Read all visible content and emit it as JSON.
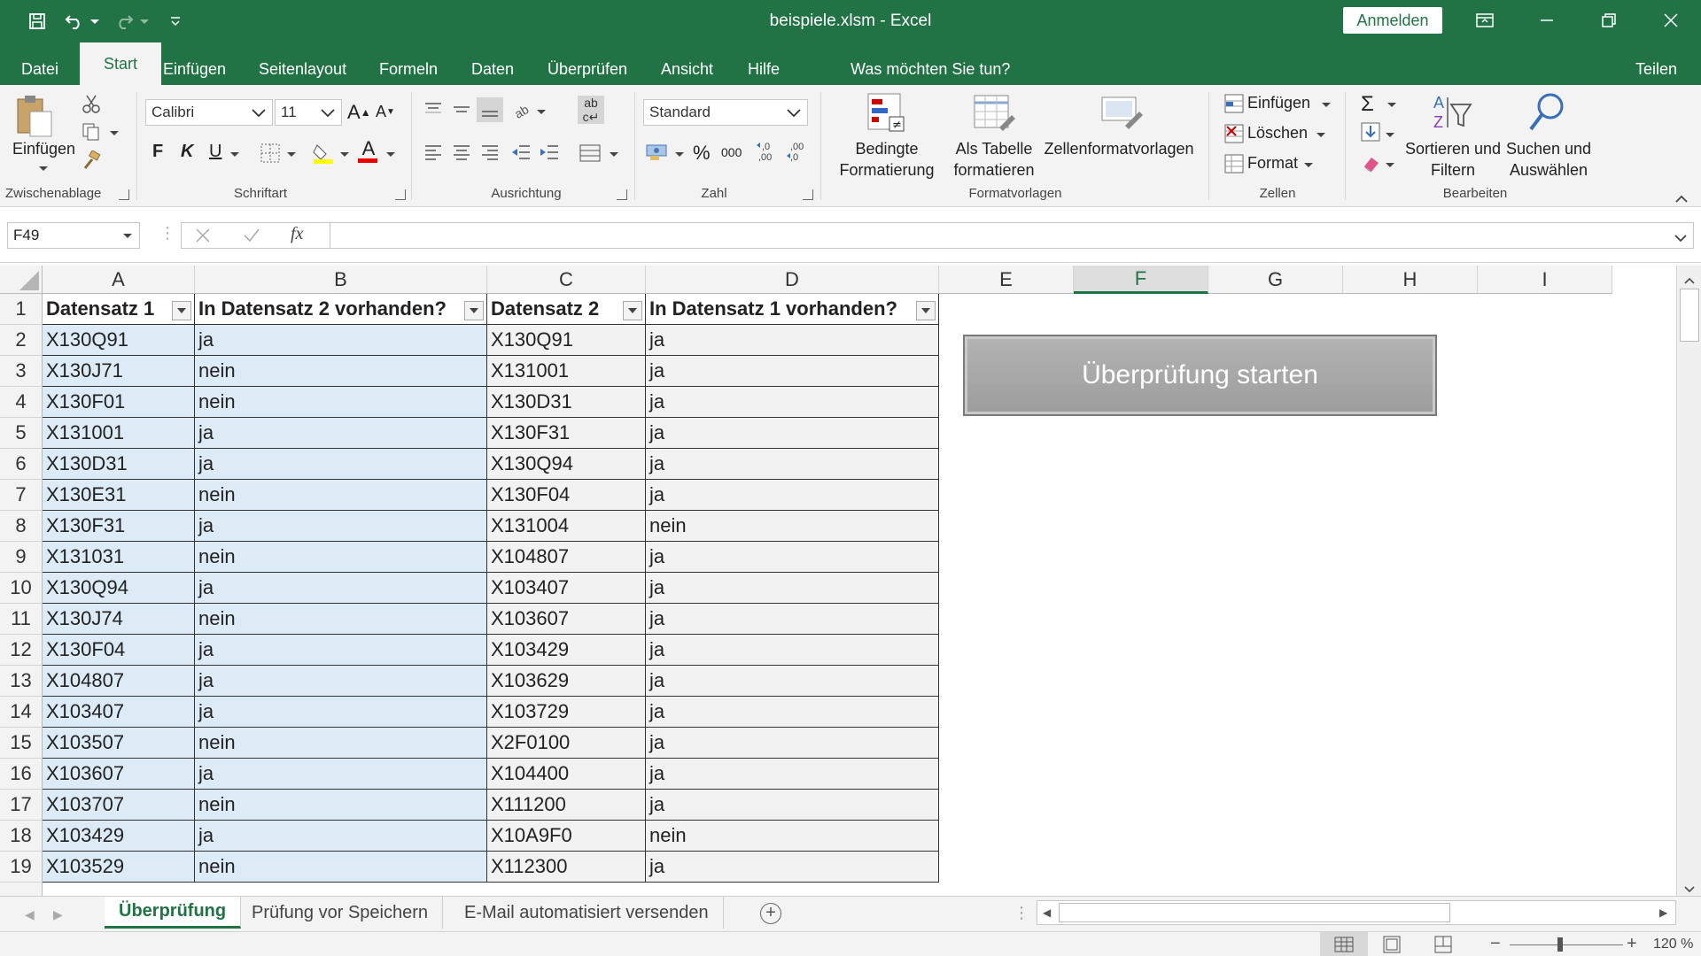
{
  "window": {
    "title": "beispiele.xlsm  -  Excel",
    "signin": "Anmelden"
  },
  "tabs": {
    "items": [
      "Datei",
      "Start",
      "Einfügen",
      "Seitenlayout",
      "Formeln",
      "Daten",
      "Überprüfen",
      "Ansicht",
      "Hilfe"
    ],
    "tellme": "Was möchten Sie tun?",
    "share": "Teilen"
  },
  "ribbon": {
    "clipboard": {
      "paste": "Einfügen",
      "label": "Zwischenablage"
    },
    "font": {
      "name": "Calibri",
      "size": "11",
      "bold": "F",
      "italic": "K",
      "underline": "U",
      "grow": "A",
      "shrink": "A",
      "color_letter": "A",
      "label": "Schriftart"
    },
    "align": {
      "label": "Ausrichtung",
      "wrap": "ab"
    },
    "number": {
      "format": "Standard",
      "percent": "%",
      "thousands": "000",
      "label": "Zahl"
    },
    "styles": {
      "conditional_l1": "Bedingte",
      "conditional_l2": "Formatierung",
      "table_l1": "Als Tabelle",
      "table_l2": "formatieren",
      "cellstyles": "Zellenformatvorlagen",
      "label": "Formatvorlagen"
    },
    "cells": {
      "insert": "Einfügen",
      "delete": "Löschen",
      "format": "Format",
      "label": "Zellen"
    },
    "editing": {
      "sort_l1": "Sortieren und",
      "sort_l2": "Filtern",
      "find_l1": "Suchen und",
      "find_l2": "Auswählen",
      "label": "Bearbeiten"
    }
  },
  "formula": {
    "namebox": "F49",
    "fx": "fx",
    "value": ""
  },
  "columns": [
    "A",
    "B",
    "C",
    "D",
    "E",
    "F",
    "G",
    "H",
    "I"
  ],
  "headers": [
    "Datensatz 1",
    "In Datensatz 2 vorhanden?",
    "Datensatz 2",
    "In Datensatz 1 vorhanden?"
  ],
  "rows": [
    [
      "X130Q91",
      "ja",
      "X130Q91",
      "ja"
    ],
    [
      "X130J71",
      "nein",
      "X131001",
      "ja"
    ],
    [
      "X130F01",
      "nein",
      "X130D31",
      "ja"
    ],
    [
      "X131001",
      "ja",
      "X130F31",
      "ja"
    ],
    [
      "X130D31",
      "ja",
      "X130Q94",
      "ja"
    ],
    [
      "X130E31",
      "nein",
      "X130F04",
      "ja"
    ],
    [
      "X130F31",
      "ja",
      "X131004",
      "nein"
    ],
    [
      "X131031",
      "nein",
      "X104807",
      "ja"
    ],
    [
      "X130Q94",
      "ja",
      "X103407",
      "ja"
    ],
    [
      "X130J74",
      "nein",
      "X103607",
      "ja"
    ],
    [
      "X130F04",
      "ja",
      "X103429",
      "ja"
    ],
    [
      "X104807",
      "ja",
      "X103629",
      "ja"
    ],
    [
      "X103407",
      "ja",
      "X103729",
      "ja"
    ],
    [
      "X103507",
      "nein",
      "X2F0100",
      "ja"
    ],
    [
      "X103607",
      "ja",
      "X104400",
      "ja"
    ],
    [
      "X103707",
      "nein",
      "X111200",
      "ja"
    ],
    [
      "X103429",
      "ja",
      "X10A9F0",
      "nein"
    ],
    [
      "X103529",
      "nein",
      "X112300",
      "ja"
    ]
  ],
  "row_numbers": [
    "1",
    "2",
    "3",
    "4",
    "5",
    "6",
    "7",
    "8",
    "9",
    "10",
    "11",
    "12",
    "13",
    "14",
    "15",
    "16",
    "17",
    "18",
    "19"
  ],
  "macro_button": "Überprüfung starten",
  "sheets": [
    "Überprüfung",
    "Prüfung vor Speichern",
    "E-Mail automatisiert versenden"
  ],
  "status": {
    "zoom": "120 %"
  },
  "colors": {
    "accent": "#217346",
    "table_blue": "#ddebf7"
  }
}
